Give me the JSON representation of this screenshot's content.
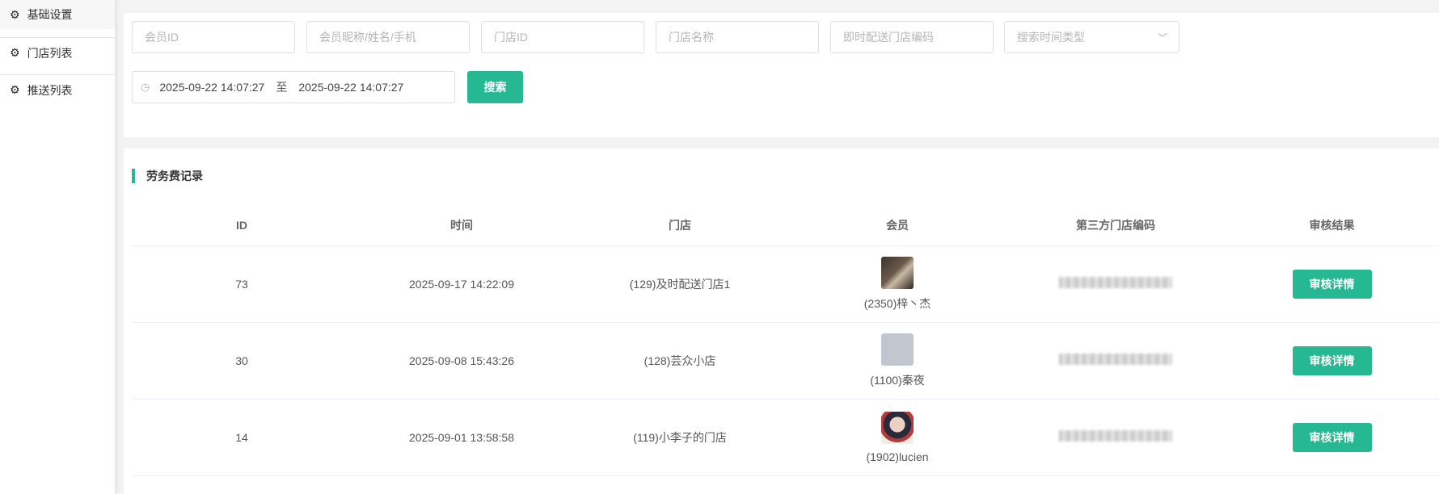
{
  "sidebar": {
    "items": [
      {
        "label": "基础设置"
      },
      {
        "label": "门店列表"
      },
      {
        "label": "推送列表"
      }
    ]
  },
  "filters": {
    "member_id": {
      "placeholder": "会员ID"
    },
    "member_name": {
      "placeholder": "会员昵称/姓名/手机"
    },
    "store_id": {
      "placeholder": "门店ID"
    },
    "store_name": {
      "placeholder": "门店名称"
    },
    "instant_code": {
      "placeholder": "即时配送门店编码"
    },
    "time_type": {
      "placeholder": "搜索时间类型"
    },
    "date_start": "2025-09-22 14:07:27",
    "date_sep": "至",
    "date_end": "2025-09-22 14:07:27",
    "search_label": "搜索"
  },
  "section_title": "劳务费记录",
  "table": {
    "headers": [
      "ID",
      "时间",
      "门店",
      "会员",
      "第三方门店编码",
      "审核结果"
    ],
    "rows": [
      {
        "id": "73",
        "time": "2025-09-17 14:22:09",
        "store": "(129)及时配送门店1",
        "member": "(2350)梓丶杰",
        "action": "审核详情"
      },
      {
        "id": "30",
        "time": "2025-09-08 15:43:26",
        "store": "(128)芸众小店",
        "member": "(1100)秦夜",
        "action": "审核详情"
      },
      {
        "id": "14",
        "time": "2025-09-01 13:58:58",
        "store": "(119)小李子的门店",
        "member": "(1902)lucien",
        "action": "审核详情"
      }
    ]
  },
  "colors": {
    "accent": "#26b893"
  }
}
